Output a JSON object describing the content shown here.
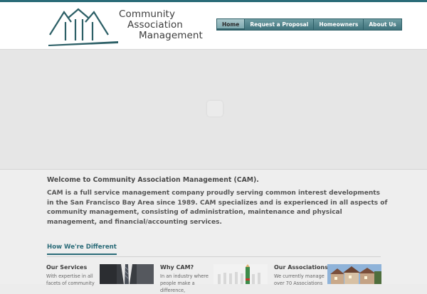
{
  "header": {
    "logo_line1": "Community",
    "logo_line2": "Association",
    "logo_line3": "Management"
  },
  "nav": {
    "items": [
      "Home",
      "Request a Proposal",
      "Homeowners",
      "About Us"
    ],
    "active": "Home"
  },
  "welcome": {
    "title": "Welcome to Community Association Management (CAM).",
    "body": "CAM is a full service management company proudly serving common interest developments in the San Francisco Bay Area since 1989.  CAM specializes and is experienced in all aspects of community management, consisting of administration, maintenance and physical management, and financial/accounting services."
  },
  "different": {
    "heading": "How We're Different",
    "columns": [
      {
        "title": "Our Services",
        "text": "With expertise in all facets of community"
      },
      {
        "title": "Why CAM?",
        "text": "In an industry where people make a difference,"
      },
      {
        "title": "Our Associations",
        "text": "We currently manage over 70 Associations"
      }
    ]
  },
  "colors": {
    "brand": "#2a6b78",
    "nav_bg": "#4f848c"
  }
}
